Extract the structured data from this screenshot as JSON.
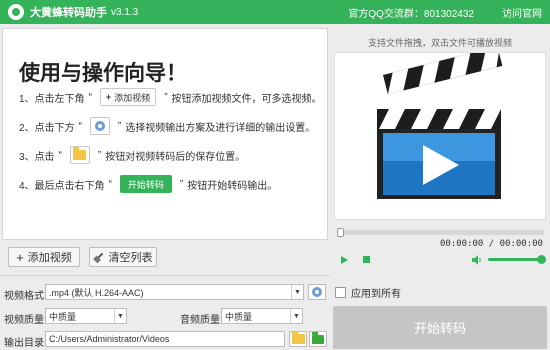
{
  "titlebar": {
    "app_title": "大黄蜂转码助手",
    "version": "v3.1.3",
    "qq_group": "官方QQ交流群：801302432",
    "official_site": "访问官网"
  },
  "guide": {
    "title": "使用与操作向导！",
    "step1": {
      "prefix": "1、点击左下角",
      "q1": "“",
      "button": "添加视频",
      "q2": "”",
      "suffix": "按钮添加视频文件，可多选视频。"
    },
    "step2": {
      "prefix": "2、点击下方",
      "q1": "“",
      "q2": "”",
      "suffix": "选择视频输出方案及进行详细的输出设置。"
    },
    "step3": {
      "prefix": "3、点击",
      "q1": "“",
      "q2": "”",
      "suffix": "按钮对视频转码后的保存位置。"
    },
    "step4": {
      "prefix": "4、最后点击右下角",
      "q1": "“",
      "button": "开始转码",
      "q2": "”",
      "suffix": "按钮开始转码输出。"
    }
  },
  "buttons": {
    "add_video": "添加视频",
    "clear_list": "清空列表",
    "start_convert": "开始转码"
  },
  "settings": {
    "format_label": "视频格式:",
    "format_value": ".mp4 (默认 H.264-AAC)",
    "video_quality_label": "视频质量:",
    "video_quality_value": "中质量",
    "audio_quality_label": "音频质量:",
    "audio_quality_value": "中质量",
    "output_label": "输出目录:",
    "output_path": "C:/Users/Administrator/Videos"
  },
  "player": {
    "drop_hint": "支持文件拖拽，双击文件可播放视频",
    "time": "00:00:00 / 00:00:00",
    "volume": 1.0
  },
  "apply_all_label": "应用到所有",
  "colors": {
    "accent": "#35b35a",
    "disabled": "#c5c5c5"
  }
}
